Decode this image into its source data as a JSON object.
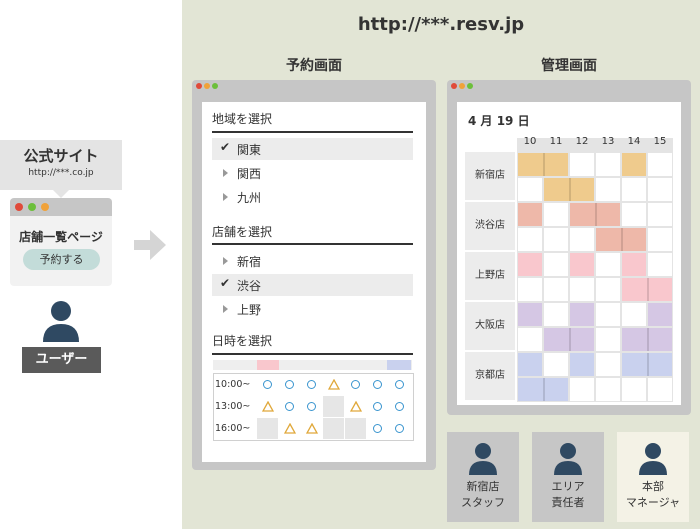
{
  "left": {
    "site_title": "公式サイト",
    "site_url": "http://***.co.jp",
    "store_list_title": "店舗一覧ページ",
    "reserve_button": "予約する",
    "user_label": "ユーザー"
  },
  "main_url": "http://***.resv.jp",
  "booking": {
    "section_title": "予約画面",
    "region_header": "地域を選択",
    "regions": [
      {
        "label": "関東",
        "selected": true
      },
      {
        "label": "関西",
        "selected": false
      },
      {
        "label": "九州",
        "selected": false
      }
    ],
    "store_header": "店舗を選択",
    "stores": [
      {
        "label": "新宿",
        "selected": false
      },
      {
        "label": "渋谷",
        "selected": true
      },
      {
        "label": "上野",
        "selected": false
      }
    ],
    "datetime_header": "日時を選択",
    "times": [
      "10:00~",
      "13:00~",
      "16:00~"
    ],
    "availability": [
      [
        "circle",
        "circle",
        "circle",
        "triangle",
        "circle",
        "circle",
        "circle"
      ],
      [
        "triangle",
        "circle",
        "circle",
        "none",
        "triangle",
        "circle",
        "circle"
      ],
      [
        "none",
        "triangle",
        "triangle",
        "none",
        "none",
        "circle",
        "circle"
      ]
    ],
    "colors": {
      "circle": "#3a95cf",
      "triangle": "#e0a83a",
      "day_pink": "#f9c7cd",
      "day_blue": "#c9d1ee"
    }
  },
  "admin": {
    "section_title": "管理画面",
    "date": "4 月 19 日",
    "hours": [
      "10",
      "11",
      "12",
      "13",
      "14",
      "15"
    ],
    "stores": [
      "新宿店",
      "渋谷店",
      "上野店",
      "大阪店",
      "京都店"
    ],
    "store_colors": [
      "#efcb8d",
      "#eeb8a9",
      "#f9c7cd",
      "#d5c7e4",
      "#c9d1ee"
    ],
    "bookings": [
      [
        [
          0,
          0,
          2
        ],
        [
          0,
          4,
          1
        ],
        [
          1,
          1,
          2
        ]
      ],
      [
        [
          0,
          0,
          1
        ],
        [
          0,
          2,
          2
        ],
        [
          1,
          3,
          2
        ]
      ],
      [
        [
          0,
          0,
          1
        ],
        [
          0,
          2,
          1
        ],
        [
          0,
          4,
          1
        ],
        [
          1,
          4,
          2
        ]
      ],
      [
        [
          0,
          0,
          1
        ],
        [
          0,
          2,
          1
        ],
        [
          0,
          5,
          1
        ],
        [
          1,
          1,
          2
        ],
        [
          1,
          4,
          2
        ]
      ],
      [
        [
          0,
          0,
          1
        ],
        [
          0,
          2,
          1
        ],
        [
          0,
          4,
          2
        ],
        [
          1,
          0,
          2
        ]
      ]
    ]
  },
  "roles": [
    {
      "line1": "新宿店",
      "line2": "スタッフ"
    },
    {
      "line1": "エリア",
      "line2": "責任者"
    },
    {
      "line1": "本部",
      "line2": "マネージャ"
    }
  ]
}
